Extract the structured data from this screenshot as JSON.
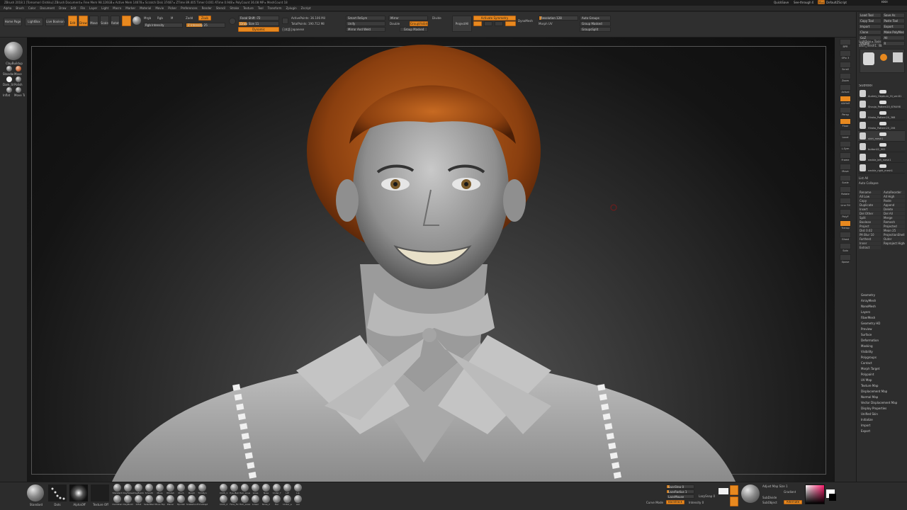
{
  "titlebar": {
    "text": "ZBrush 2018.1 [Tomomori Oishiku]   ZBrush Document   ▸ Free Mem 98.126GB ▸ Active Mem 14678 ▸ Scratch Disk 37487 ▸ ZTime 89.405 Timer 0.001 ATime 0.948 ▸ PolyCount 36.08 MP ▸ MeshCount 18"
  },
  "menubar": {
    "items": [
      "Alpha",
      "Brush",
      "Color",
      "Document",
      "Draw",
      "Edit",
      "File",
      "Layer",
      "Light",
      "Macro",
      "Marker",
      "Material",
      "Movie",
      "Picker",
      "Preferences",
      "Render",
      "Stencil",
      "Stroke",
      "Texture",
      "Tool",
      "Transform",
      "Zplugin",
      "Zscript"
    ]
  },
  "topshelf": {
    "home_page": "Home Page",
    "lightbox": "LightBox",
    "live_boolean": "Live Boolean",
    "edit": "Edit",
    "draw": "Draw",
    "move": "Move",
    "scale": "Scale",
    "rotate": "Rotate",
    "mrgb": "Mrgb",
    "rgb": "Rgb",
    "m": "M",
    "zadd": "Zadd",
    "zsub": "Zsub",
    "rgb_intensity": "Rgb Intensity",
    "z_intensity": "Z Intensity 25",
    "focal_shift": "Focal Shift -72",
    "draw_size": "Draw Size 11",
    "dynamic": "Dynamic",
    "active_points": "ActivePoints: 36.106 Mil",
    "total_points": "TotalPoints: 190.712 Mil",
    "japanese": "日本語 Japanese",
    "smart_resym": "Smart ReSym",
    "unify": "Unify",
    "mirror_and_weld": "Mirror And Weld",
    "mirror": "Mirror",
    "double": "Double",
    "group_visible": "GroupVisible",
    "group_masked": "Group Masked",
    "divide": "Divide",
    "project_all": "ProjectAll",
    "activate_symmetry": "Activate Symmetry",
    "dyn_subdiv": "DynaMesh",
    "resolution": "Resolution 128",
    "morph_uv": "Morph UV",
    "groups_split": "GroupsSplit",
    "group_masked2": "Group Masked",
    "auto_groups": "Auto Groups",
    "quicksave": "QuickSave",
    "see_through": "See-through 0",
    "menus": "Menus",
    "default_zscript": "DefaultZScript"
  },
  "rightpanel": {
    "header": "Tool",
    "top_buttons": [
      "Load Tool",
      "Save As",
      "Copy Tool",
      "Paste Tool",
      "Import",
      "Export",
      "Clone",
      "Make PolyMesh3D",
      "GoZ",
      "All",
      "Visible",
      "R"
    ],
    "lightbox_tools": "Lightbox ▸ Tools",
    "tool_name": "Shirt_mesh1. 48",
    "subtool_header": "Subtool",
    "subtools": [
      "Audrey_Hepburn_Hi_ver.61",
      "Shoujo_Pattern20_676498",
      "Hiroko_Pattern20_368",
      "Hiroko_Pattern20_206",
      "shirt_mesh1",
      "button02_002",
      "neckle_left_mesh1",
      "neckle_right_mesh1"
    ],
    "list_all": "List All",
    "auto_collapse": "Auto Collapse",
    "actions": [
      "Rename",
      "AutoReorder",
      "All Low",
      "All High",
      "Copy",
      "Paste",
      "Duplicate",
      "Append",
      "Insert",
      "Delete",
      "Del Other",
      "Del All",
      "Split",
      "Merge",
      "Boolean",
      "Remesh",
      "Project",
      "Projected",
      "Dist 0.02",
      "Mean 25",
      "PA Blur 10",
      "ProjectionShell 0",
      "Farthest",
      "Outer",
      "Inner",
      "Reproject Higher Subdiv",
      "Extract"
    ],
    "palettes": [
      "Geometry",
      "ArrayMesh",
      "NanoMesh",
      "Layers",
      "FiberMesh",
      "Geometry HD",
      "Preview",
      "Surface",
      "Deformation",
      "Masking",
      "Visibility",
      "Polygroups",
      "Contact",
      "Morph Target",
      "Polypaint",
      "UV Map",
      "Texture Map",
      "Displacement Map",
      "Normal Map",
      "Vector Displacement Map",
      "Display Properties",
      "Unified Skin",
      "Initialize",
      "Import",
      "Export"
    ]
  },
  "rightstrip": {
    "labels": [
      "BPR",
      "SPix 3",
      "Scroll",
      "Zoom",
      "Actual",
      "AAHalf",
      "Persp",
      "Floor",
      "Local",
      "L.Sym",
      "Frame",
      "Move",
      "Scale",
      "Rotate",
      "Line Fill",
      "PolyF",
      "Transp",
      "Ghost",
      "Solo",
      "Xpose"
    ]
  },
  "leftshelf": {
    "labels": [
      "ClayBuildup",
      "Standard",
      "Move",
      "Dam_Stan",
      "Polish",
      "Inflat",
      "Move Top",
      "Pinch",
      "TrimDyn",
      "hPolish"
    ]
  },
  "bottomshelf": {
    "brushes": [
      "Standard",
      "Dots",
      "AlphaOff",
      "Texture Off"
    ],
    "brush_row1": [
      "Standard",
      "ClayTubes",
      "ClayBuildup",
      "Smooth",
      "Move",
      "HPolish",
      "Pinch",
      "Morph",
      "TrimDyn"
    ],
    "brush_row2": [
      "DamStan",
      "ClayBuild",
      "Inflat",
      "SelectRect",
      "Move Top",
      "Planar",
      "Hpolish",
      "Snakehook",
      "TrimAdapt"
    ],
    "brush_row3": [
      "Cloth_1",
      "Eye_Ball",
      "Hair_Lines",
      "Lines",
      "Nose",
      "Under_f",
      "LIP",
      "Lip"
    ],
    "brush_row4": [
      "Cloth_2",
      "Face_Fix",
      "Hair_Lower",
      "Lower",
      "Nose_2",
      "Ear",
      "Under_e",
      "ear"
    ],
    "lazy_mouse": "LazyMouse",
    "lazy_step": "LazyStep 0",
    "lazy_radius": "LazyRadius 1",
    "backtrack": "Backtrack",
    "curve_mode": "Curve Mode",
    "lazy_snap": "LazySnap 0",
    "intensity": "Intensity 0",
    "alternate": "Alternate",
    "adjust_map": "Adjust Map Size 1",
    "sub_divide": "SubDivide",
    "sub_object": "SubObject",
    "gradient": "Gradient",
    "switch_color": "SwitchColor"
  },
  "colors": {
    "accent": "#e8891f",
    "panel": "#2d2d2d",
    "canvas_dark": "#0e0e0e"
  }
}
